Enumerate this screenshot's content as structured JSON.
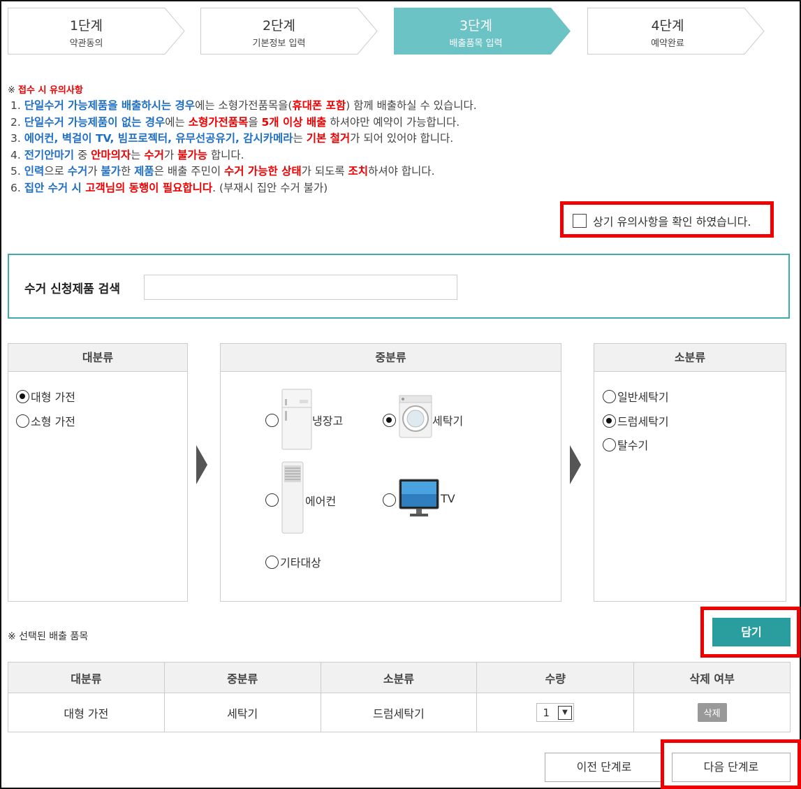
{
  "steps": [
    {
      "num": "1단계",
      "label": "약관동의",
      "active": false
    },
    {
      "num": "2단계",
      "label": "기본정보 입력",
      "active": false
    },
    {
      "num": "3단계",
      "label": "배출품목 입력",
      "active": true
    },
    {
      "num": "4단계",
      "label": "예약완료",
      "active": false
    }
  ],
  "colors": {
    "active_step": "#6cc3c6",
    "accent": "#2a9d9f",
    "highlight": "#e00000",
    "link_blue": "#1f6fc6"
  },
  "notice": {
    "prefix": "※ ",
    "title": "접수 시 유의사항",
    "lines": [
      [
        {
          "t": "1. ",
          "c": ""
        },
        {
          "t": "단일수거 가능제품을 배출하시는 경우",
          "c": "b"
        },
        {
          "t": "에는 소형가전품목을(",
          "c": ""
        },
        {
          "t": "휴대폰 포함",
          "c": "r"
        },
        {
          "t": ") 함께 배출하실 수 있습니다.",
          "c": ""
        }
      ],
      [
        {
          "t": "2. ",
          "c": ""
        },
        {
          "t": "단일수거 가능제품이 없는 경우",
          "c": "b"
        },
        {
          "t": "에는 ",
          "c": ""
        },
        {
          "t": "소형가전품목",
          "c": "r"
        },
        {
          "t": "을 ",
          "c": ""
        },
        {
          "t": "5개 이상 배출",
          "c": "r"
        },
        {
          "t": " 하셔야만 예약이 가능합니다.",
          "c": ""
        }
      ],
      [
        {
          "t": "3. ",
          "c": ""
        },
        {
          "t": "에어컨, 벽걸이 TV, 빔프로젝터, 유무선공유기, 감시카메라",
          "c": "b"
        },
        {
          "t": "는 ",
          "c": ""
        },
        {
          "t": "기본 철거",
          "c": "r"
        },
        {
          "t": "가 되어 있어야 합니다.",
          "c": ""
        }
      ],
      [
        {
          "t": "4. ",
          "c": ""
        },
        {
          "t": "전기안마기",
          "c": "b"
        },
        {
          "t": " 중 ",
          "c": ""
        },
        {
          "t": "안마의자",
          "c": "r"
        },
        {
          "t": "는 ",
          "c": ""
        },
        {
          "t": "수거",
          "c": "r"
        },
        {
          "t": "가 ",
          "c": ""
        },
        {
          "t": "불가능",
          "c": "r"
        },
        {
          "t": " 합니다.",
          "c": ""
        }
      ],
      [
        {
          "t": "5. ",
          "c": ""
        },
        {
          "t": "인력",
          "c": "b"
        },
        {
          "t": "으로 ",
          "c": ""
        },
        {
          "t": "수거",
          "c": "b"
        },
        {
          "t": "가 ",
          "c": ""
        },
        {
          "t": "불가",
          "c": "b"
        },
        {
          "t": "한 ",
          "c": ""
        },
        {
          "t": "제품",
          "c": "b"
        },
        {
          "t": "은 배출 주민이 ",
          "c": ""
        },
        {
          "t": "수거 가능한 상태",
          "c": "r"
        },
        {
          "t": "가 되도록 ",
          "c": ""
        },
        {
          "t": "조치",
          "c": "r"
        },
        {
          "t": "하셔야 합니다.",
          "c": ""
        }
      ],
      [
        {
          "t": "6. ",
          "c": ""
        },
        {
          "t": "집안 수거 시 ",
          "c": "b"
        },
        {
          "t": "고객님의 동행이 필요합니다",
          "c": "r"
        },
        {
          "t": ". (부재시 집안 수거 불가)",
          "c": ""
        }
      ]
    ]
  },
  "confirm_label": "상기 유의사항을 확인 하였습니다.",
  "search": {
    "label": "수거 신청제품 검색",
    "value": "",
    "placeholder": ""
  },
  "category": {
    "major": {
      "title": "대분류",
      "options": [
        {
          "label": "대형 가전",
          "checked": true
        },
        {
          "label": "소형 가전",
          "checked": false
        }
      ]
    },
    "middle": {
      "title": "중분류",
      "options": [
        {
          "label": "냉장고",
          "icon": "refrigerator-icon",
          "checked": false
        },
        {
          "label": "세탁기",
          "icon": "washing-machine-icon",
          "checked": true
        },
        {
          "label": "에어컨",
          "icon": "air-conditioner-icon",
          "checked": false
        },
        {
          "label": "TV",
          "icon": "tv-icon",
          "checked": false
        },
        {
          "label": "기타대상",
          "icon": "",
          "checked": false
        }
      ]
    },
    "minor": {
      "title": "소분류",
      "options": [
        {
          "label": "일반세탁기",
          "checked": false
        },
        {
          "label": "드럼세탁기",
          "checked": true
        },
        {
          "label": "탈수기",
          "checked": false
        }
      ]
    }
  },
  "selected_label": "※ 선택된 배출 품목",
  "add_button": "담기",
  "table": {
    "headers": [
      "대분류",
      "중분류",
      "소분류",
      "수량",
      "삭제 여부"
    ],
    "rows": [
      {
        "major": "대형 가전",
        "middle": "세탁기",
        "minor": "드럼세탁기",
        "qty": "1",
        "delete": "삭제"
      }
    ]
  },
  "prev_button": "이전 단계로",
  "next_button": "다음 단계로"
}
